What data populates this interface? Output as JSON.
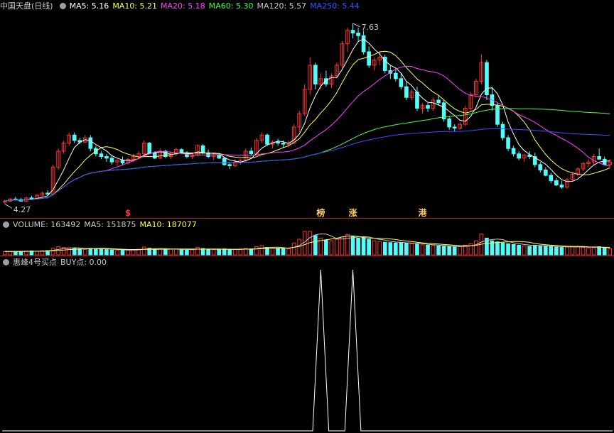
{
  "price_header": {
    "title": "中国天盘(日线)",
    "items": [
      {
        "label": "MA5: 5.16",
        "color": "#ffffff"
      },
      {
        "label": "MA10: 5.21",
        "color": "#ffff55"
      },
      {
        "label": "MA20: 5.18",
        "color": "#ff44ff"
      },
      {
        "label": "MA60: 5.30",
        "color": "#44ff44"
      },
      {
        "label": "MA120: 5.57",
        "color": "#c8c8c8"
      },
      {
        "label": "MA250: 5.44",
        "color": "#3355ff"
      }
    ]
  },
  "volume_header": {
    "items": [
      {
        "label": "VOLUME: 163492",
        "color": "#c8c8c8"
      },
      {
        "label": "MA5: 151875",
        "color": "#c8c8c8"
      },
      {
        "label": "MA10: 187077",
        "color": "#ffff55"
      }
    ]
  },
  "indicator_header": {
    "items": [
      {
        "label": "惠峰4号买点",
        "color": "#c8c8c8"
      },
      {
        "label": "BUY点: 0.00",
        "color": "#c8c8c8"
      }
    ]
  },
  "annotations": {
    "high_label": "7.63",
    "low_label": "4.27",
    "markers": [
      {
        "text": "$",
        "x_index": 23,
        "color": "#ff3333"
      },
      {
        "text": "榜",
        "x_index": 59,
        "color": "#ffcc66"
      },
      {
        "text": "涨",
        "x_index": 65,
        "color": "#ffcc66"
      },
      {
        "text": "港",
        "x_index": 78,
        "color": "#ffcc66"
      }
    ]
  },
  "colors": {
    "up": "#ff3333",
    "down": "#54fcfc",
    "background": "#000000"
  },
  "chart_data": {
    "type": "candlestick",
    "price_range": [
      4.1,
      7.8
    ],
    "ohlc": [
      [
        4.3,
        4.35,
        4.27,
        4.32
      ],
      [
        4.32,
        4.38,
        4.3,
        4.36
      ],
      [
        4.36,
        4.4,
        4.33,
        4.35
      ],
      [
        4.35,
        4.38,
        4.31,
        4.32
      ],
      [
        4.32,
        4.4,
        4.3,
        4.38
      ],
      [
        4.38,
        4.42,
        4.35,
        4.37
      ],
      [
        4.37,
        4.45,
        4.36,
        4.43
      ],
      [
        4.43,
        4.5,
        4.41,
        4.47
      ],
      [
        4.47,
        4.52,
        4.44,
        4.45
      ],
      [
        4.45,
        5.0,
        4.44,
        4.95
      ],
      [
        4.95,
        5.3,
        4.9,
        5.25
      ],
      [
        5.25,
        5.45,
        5.2,
        5.4
      ],
      [
        5.4,
        5.6,
        5.35,
        5.55
      ],
      [
        5.55,
        5.6,
        5.4,
        5.45
      ],
      [
        5.45,
        5.5,
        5.38,
        5.42
      ],
      [
        5.42,
        5.55,
        5.4,
        5.5
      ],
      [
        5.5,
        5.55,
        5.25,
        5.3
      ],
      [
        5.3,
        5.35,
        5.15,
        5.2
      ],
      [
        5.2,
        5.25,
        5.1,
        5.15
      ],
      [
        5.15,
        5.2,
        5.05,
        5.12
      ],
      [
        5.12,
        5.18,
        5.0,
        5.05
      ],
      [
        5.05,
        5.1,
        4.98,
        5.08
      ],
      [
        5.08,
        5.15,
        5.0,
        5.03
      ],
      [
        5.03,
        5.12,
        5.0,
        5.1
      ],
      [
        5.1,
        5.2,
        5.05,
        5.15
      ],
      [
        5.15,
        5.25,
        5.1,
        5.2
      ],
      [
        5.2,
        5.45,
        5.18,
        5.4
      ],
      [
        5.4,
        5.42,
        5.2,
        5.22
      ],
      [
        5.22,
        5.25,
        5.1,
        5.12
      ],
      [
        5.12,
        5.3,
        5.1,
        5.25
      ],
      [
        5.25,
        5.28,
        5.12,
        5.15
      ],
      [
        5.15,
        5.25,
        5.1,
        5.2
      ],
      [
        5.2,
        5.32,
        5.15,
        5.28
      ],
      [
        5.28,
        5.3,
        5.2,
        5.22
      ],
      [
        5.22,
        5.25,
        5.12,
        5.15
      ],
      [
        5.15,
        5.2,
        5.1,
        5.18
      ],
      [
        5.18,
        5.38,
        5.15,
        5.35
      ],
      [
        5.35,
        5.38,
        5.2,
        5.22
      ],
      [
        5.22,
        5.28,
        5.12,
        5.15
      ],
      [
        5.15,
        5.2,
        5.08,
        5.18
      ],
      [
        5.18,
        5.22,
        5.1,
        5.12
      ],
      [
        5.12,
        5.15,
        4.98,
        5.0
      ],
      [
        5.0,
        5.05,
        4.92,
        4.98
      ],
      [
        4.98,
        5.1,
        4.95,
        5.05
      ],
      [
        5.05,
        5.1,
        5.0,
        5.08
      ],
      [
        5.08,
        5.3,
        5.05,
        5.25
      ],
      [
        5.25,
        5.32,
        5.18,
        5.2
      ],
      [
        5.2,
        5.5,
        5.18,
        5.45
      ],
      [
        5.45,
        5.6,
        5.4,
        5.55
      ],
      [
        5.55,
        5.58,
        5.35,
        5.38
      ],
      [
        5.38,
        5.45,
        5.3,
        5.42
      ],
      [
        5.42,
        5.48,
        5.35,
        5.4
      ],
      [
        5.4,
        5.45,
        5.32,
        5.38
      ],
      [
        5.38,
        5.45,
        5.32,
        5.4
      ],
      [
        5.4,
        5.75,
        5.38,
        5.7
      ],
      [
        5.7,
        6.0,
        5.6,
        5.95
      ],
      [
        5.95,
        6.5,
        5.9,
        6.4
      ],
      [
        6.4,
        7.0,
        6.3,
        6.85
      ],
      [
        6.85,
        6.9,
        6.4,
        6.5
      ],
      [
        6.5,
        6.7,
        6.4,
        6.6
      ],
      [
        6.6,
        6.75,
        6.45,
        6.5
      ],
      [
        6.5,
        6.7,
        6.42,
        6.65
      ],
      [
        6.65,
        6.9,
        6.6,
        6.85
      ],
      [
        6.85,
        7.3,
        6.8,
        7.25
      ],
      [
        7.25,
        7.55,
        7.1,
        7.5
      ],
      [
        7.5,
        7.63,
        7.35,
        7.45
      ],
      [
        7.45,
        7.55,
        7.3,
        7.4
      ],
      [
        7.4,
        7.5,
        7.05,
        7.1
      ],
      [
        7.1,
        7.2,
        6.8,
        6.85
      ],
      [
        6.85,
        7.0,
        6.75,
        6.95
      ],
      [
        6.95,
        7.1,
        6.85,
        7.0
      ],
      [
        7.0,
        7.05,
        6.7,
        6.75
      ],
      [
        6.75,
        6.85,
        6.6,
        6.7
      ],
      [
        6.7,
        6.8,
        6.55,
        6.6
      ],
      [
        6.6,
        6.7,
        6.4,
        6.45
      ],
      [
        6.45,
        6.55,
        6.2,
        6.25
      ],
      [
        6.25,
        6.4,
        6.2,
        6.35
      ],
      [
        6.35,
        6.45,
        6.0,
        6.05
      ],
      [
        6.05,
        6.15,
        5.95,
        6.1
      ],
      [
        6.1,
        6.15,
        5.98,
        6.05
      ],
      [
        6.05,
        6.25,
        6.0,
        6.2
      ],
      [
        6.2,
        6.3,
        6.1,
        6.15
      ],
      [
        6.15,
        6.2,
        5.8,
        5.85
      ],
      [
        5.85,
        5.9,
        5.65,
        5.7
      ],
      [
        5.7,
        5.75,
        5.62,
        5.68
      ],
      [
        5.68,
        5.78,
        5.65,
        5.75
      ],
      [
        5.75,
        6.1,
        5.72,
        6.05
      ],
      [
        6.05,
        6.35,
        6.0,
        6.3
      ],
      [
        6.3,
        6.6,
        6.25,
        6.55
      ],
      [
        6.55,
        7.05,
        6.5,
        6.9
      ],
      [
        6.9,
        6.95,
        6.2,
        6.3
      ],
      [
        6.3,
        6.45,
        6.0,
        6.1
      ],
      [
        6.1,
        6.15,
        5.7,
        5.75
      ],
      [
        5.75,
        5.8,
        5.45,
        5.5
      ],
      [
        5.5,
        5.55,
        5.25,
        5.3
      ],
      [
        5.3,
        5.35,
        5.15,
        5.2
      ],
      [
        5.2,
        5.25,
        5.08,
        5.12
      ],
      [
        5.12,
        5.2,
        5.05,
        5.18
      ],
      [
        5.18,
        5.25,
        5.1,
        5.15
      ],
      [
        5.15,
        5.22,
        4.95,
        5.0
      ],
      [
        5.0,
        5.05,
        4.85,
        4.9
      ],
      [
        4.9,
        4.95,
        4.78,
        4.8
      ],
      [
        4.8,
        4.85,
        4.65,
        4.7
      ],
      [
        4.7,
        4.75,
        4.6,
        4.62
      ],
      [
        4.62,
        4.7,
        4.55,
        4.58
      ],
      [
        4.58,
        4.75,
        4.55,
        4.72
      ],
      [
        4.72,
        4.85,
        4.7,
        4.82
      ],
      [
        4.82,
        4.95,
        4.78,
        4.92
      ],
      [
        4.92,
        5.05,
        4.88,
        5.02
      ],
      [
        5.02,
        5.1,
        4.95,
        5.05
      ],
      [
        5.05,
        5.2,
        5.0,
        5.15
      ],
      [
        5.15,
        5.3,
        5.1,
        5.1
      ],
      [
        5.1,
        5.15,
        4.98,
        5.0
      ],
      [
        5.0,
        5.1,
        4.95,
        5.05
      ]
    ],
    "volume_range": [
      0,
      1200000
    ],
    "volume": [
      90000,
      95000,
      88000,
      92000,
      100000,
      105000,
      98000,
      110000,
      115000,
      180000,
      220000,
      200000,
      190000,
      170000,
      160000,
      150000,
      175000,
      165000,
      160000,
      140000,
      130000,
      120000,
      135000,
      128000,
      140000,
      150000,
      210000,
      180000,
      150000,
      160000,
      145000,
      150000,
      158000,
      140000,
      130000,
      135000,
      200000,
      170000,
      150000,
      140000,
      135000,
      160000,
      150000,
      145000,
      140000,
      170000,
      160000,
      220000,
      250000,
      200000,
      180000,
      175000,
      170000,
      165000,
      320000,
      420000,
      650000,
      780000,
      520000,
      450000,
      400000,
      380000,
      420000,
      480000,
      550000,
      500000,
      450000,
      480000,
      420000,
      380000,
      360000,
      340000,
      330000,
      320000,
      330000,
      310000,
      300000,
      290000,
      270000,
      260000,
      250000,
      240000,
      230000,
      220000,
      210000,
      220000,
      260000,
      300000,
      380000,
      560000,
      450000,
      380000,
      350000,
      320000,
      300000,
      280000,
      260000,
      240000,
      230000,
      260000,
      250000,
      240000,
      220000,
      210000,
      200000,
      210000,
      220000,
      230000,
      200000,
      190000,
      195000,
      220000,
      180000,
      163492
    ],
    "buy_signal": {
      "range": [
        0,
        1
      ],
      "x_index": [
        59,
        65
      ],
      "value": 1
    }
  }
}
